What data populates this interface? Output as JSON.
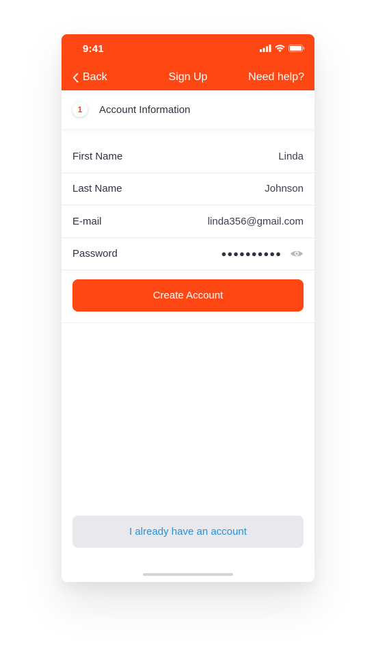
{
  "status_bar": {
    "time": "9:41",
    "icons": [
      "signal-icon",
      "wifi-icon",
      "battery-icon"
    ]
  },
  "nav": {
    "back_label": "Back",
    "title": "Sign Up",
    "help_label": "Need help?"
  },
  "step": {
    "number": "1",
    "label": "Account Information"
  },
  "form": {
    "fields": [
      {
        "label": "First Name",
        "value": "Linda"
      },
      {
        "label": "Last Name",
        "value": "Johnson"
      },
      {
        "label": "E-mail",
        "value": "linda356@gmail.com"
      },
      {
        "label": "Password",
        "value": "●●●●●●●●●●"
      }
    ]
  },
  "actions": {
    "create_label": "Create Account",
    "login_label": "I already have an account"
  },
  "colors": {
    "accent": "#ff4713",
    "link": "#2d8fd5",
    "secondary_button_bg": "#e8e9ec",
    "text": "#2f3140"
  }
}
